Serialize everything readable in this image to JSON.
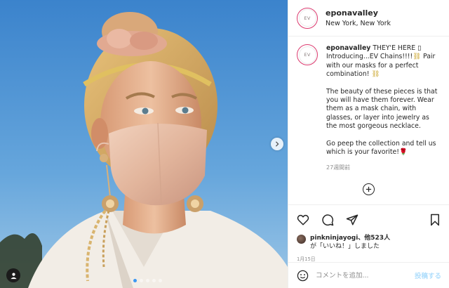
{
  "post": {
    "username": "eponavalley",
    "location": "New York, New York",
    "avatar_initials": "EV",
    "caption_line1": "THEY'E HERE ",
    "caption_missing_glyph": "▯",
    "caption_line2": "Introducing...EV Chains!!!!",
    "chain_emoji": "⛓",
    "caption_line3": " Pair with our masks for a perfect combination!",
    "caption_para2": "The beauty of these pieces is that you will have them forever. Wear them as a mask chain, with glasses, or layer into jewelry as the most gorgeous necklace.",
    "caption_para3": "Go peep the collection and tell us which is your favorite!",
    "rose_emoji": "🌹",
    "time_ago": "27週間前"
  },
  "likes": {
    "liker": "pinkninjayogi",
    "suffix_count": "、他523人",
    "suffix_text": "が「いいね！」しました"
  },
  "post_date": "1月15日",
  "comment": {
    "placeholder": "コメントを追加...",
    "post_label": "投稿する"
  },
  "carousel": {
    "slide_count": 5,
    "active_index": 0
  },
  "icons": {
    "like": "heart-icon",
    "comment": "comment-icon",
    "share": "share-icon",
    "save": "bookmark-icon",
    "emoji": "smiley-icon",
    "load_more": "plus-circle-icon",
    "next": "chevron-right-icon",
    "tag": "person-tag-icon"
  },
  "colors": {
    "story_ring": "#dc3a6f",
    "link_blue": "#b2dffc",
    "active_dot": "#3b97f3"
  }
}
